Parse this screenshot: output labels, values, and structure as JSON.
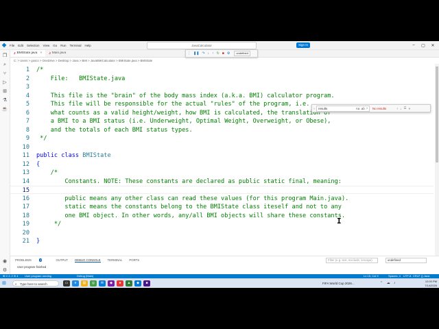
{
  "titlebar": {
    "menu": [
      "File",
      "Edit",
      "Selection",
      "View",
      "Go",
      "Run",
      "Terminal",
      "Help"
    ],
    "command_center": "JavaCalculator",
    "debug_config": "undefined",
    "sign_in": "Sign In"
  },
  "tabs": [
    {
      "label": "BMIState.java",
      "active": true,
      "modified": false
    },
    {
      "label": "Main.java",
      "active": false
    }
  ],
  "breadcrumb": "C: > Users > gosco > OneDrive > Desktop > Java > BMI > JavaBMICalculator > BMIState.java > BMIState",
  "find": {
    "query": "results",
    "options": "Aa .ab .*",
    "status": "No results"
  },
  "editor": {
    "current_line": 15,
    "lines": [
      {
        "n": "1",
        "text": "/*"
      },
      {
        "n": "2",
        "text": "    File:   BMIState.java"
      },
      {
        "n": "3",
        "text": ""
      },
      {
        "n": "4",
        "text": "    This file is the \"brain\" of the body mass index (a.k.a. BMI) calculator program."
      },
      {
        "n": "5",
        "text": "    This file will be responsible for the actual \"rules\" of the program, i.e."
      },
      {
        "n": "6",
        "text": "    what counts as a valid height/weight, how BMI is calculated, the translation of"
      },
      {
        "n": "7",
        "text": "    a BMI to a BMI status (i.e. Underweight, Optimal Weight, Overweight, or Obese),"
      },
      {
        "n": "8",
        "text": "    and the totals of each BMI status types."
      },
      {
        "n": "9",
        "text": " */"
      },
      {
        "n": "10",
        "text": ""
      },
      {
        "n": "11",
        "kw": "public class ",
        "ty": "BMIState",
        "text": ""
      },
      {
        "n": "12",
        "br": "{",
        "text": ""
      },
      {
        "n": "13",
        "text": "    /*"
      },
      {
        "n": "14",
        "text": "        Constants. NOTE: These constants are declared as public static final, meaning:"
      },
      {
        "n": "15",
        "text": ""
      },
      {
        "n": "16",
        "text": "        public means any other class can read these values (for this program Main.java)."
      },
      {
        "n": "17",
        "text": "        static means the constants belong to the BMIState class iteself and not to any"
      },
      {
        "n": "18",
        "text": "        one BMI object. In other words, any/all BMI objects will share these constants."
      },
      {
        "n": "19",
        "text": "     */"
      },
      {
        "n": "20",
        "text": ""
      },
      {
        "n": "21",
        "br": "}",
        "text": ""
      }
    ]
  },
  "panel": {
    "tabs": [
      "PROBLEMS",
      "OUTPUT",
      "DEBUG CONSOLE",
      "TERMINAL",
      "PORTS"
    ],
    "problems_badge": "2",
    "active_tab": "DEBUG CONSOLE",
    "filter_placeholder": "Filter (e.g. text, !exclude, \\escape)",
    "select_value": "undefined",
    "output": "User program finished"
  },
  "statusbar": {
    "left": "⊗ 0 ⚠ 2  ⊘ 4",
    "running": "User program running",
    "debug": "Debug (Main)",
    "position": "Ln 15, Col 9",
    "spaces": "Spaces: 4",
    "encoding": "UTF-8",
    "eol": "CRLF",
    "language": "{} Java"
  },
  "taskbar": {
    "search_placeholder": "Type here to search",
    "news": "FIFA World Cup 2026...",
    "time": "12:00 PM",
    "date": "7/14/2026"
  },
  "colors": {
    "accent": "#007acc",
    "comment": "#008000",
    "keyword": "#0000ff",
    "type": "#267f99",
    "line_number": "#237893"
  }
}
